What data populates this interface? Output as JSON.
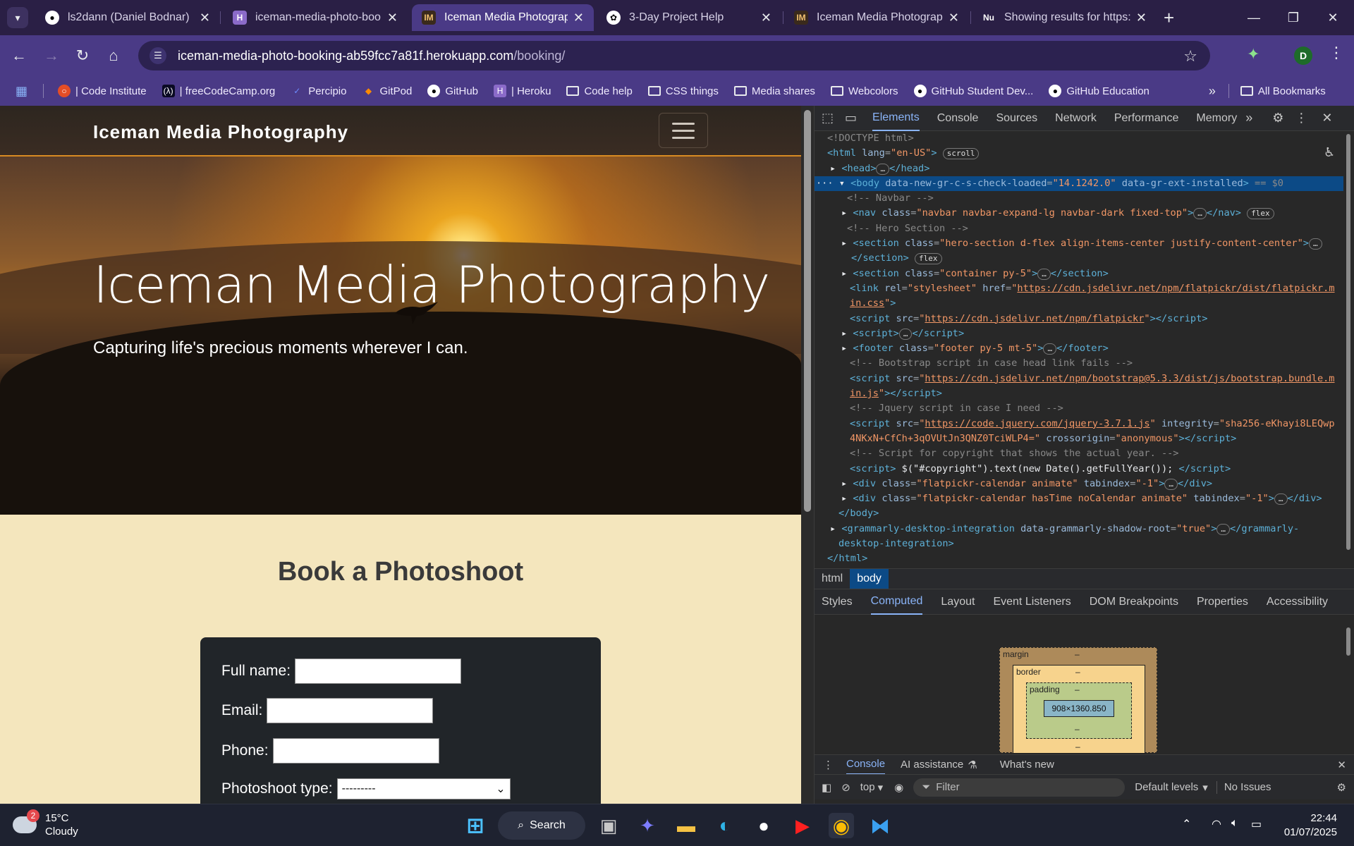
{
  "browser": {
    "tabs": [
      {
        "title": "ls2dann (Daniel Bodnar)",
        "favicon": "github-icon"
      },
      {
        "title": "iceman-media-photo-boo",
        "favicon": "heroku-icon"
      },
      {
        "title": "Iceman Media Photograph",
        "favicon": "im-icon",
        "active": true
      },
      {
        "title": "3-Day Project Help",
        "favicon": "chatgpt-icon"
      },
      {
        "title": "Iceman Media Photograph",
        "favicon": "im-icon"
      },
      {
        "title": "Showing results for https:/",
        "favicon": "nu-icon"
      }
    ],
    "url_host": "iceman-media-photo-booking-ab59fcc7a81f.herokuapp.com",
    "url_path": "/booking/",
    "profile_initial": "D",
    "bookmarks": [
      {
        "label": "| Code Institute",
        "icon": "code-institute-icon"
      },
      {
        "label": "| freeCodeCamp.org",
        "icon": "freecodecamp-icon"
      },
      {
        "label": "Percipio",
        "icon": "percipio-icon"
      },
      {
        "label": "GitPod",
        "icon": "gitpod-icon"
      },
      {
        "label": "GitHub",
        "icon": "github-icon"
      },
      {
        "label": "| Heroku",
        "icon": "heroku-icon"
      },
      {
        "label": "Code help",
        "icon": "folder-icon"
      },
      {
        "label": "CSS things",
        "icon": "folder-icon"
      },
      {
        "label": "Media shares",
        "icon": "folder-icon"
      },
      {
        "label": "Webcolors",
        "icon": "folder-icon"
      },
      {
        "label": "GitHub Student Dev...",
        "icon": "github-icon"
      },
      {
        "label": "GitHub Education",
        "icon": "github-icon"
      }
    ],
    "all_bookmarks": "All Bookmarks"
  },
  "site": {
    "brand": "Iceman Media Photography",
    "hero_title": "Iceman Media Photography",
    "hero_subtitle": "Capturing life's precious moments wherever I can.",
    "booking_heading": "Book a Photoshoot",
    "form": {
      "full_name_label": "Full name:",
      "email_label": "Email:",
      "phone_label": "Phone:",
      "type_label": "Photoshoot type:",
      "type_selected": "---------"
    }
  },
  "devtools": {
    "tabs": [
      "Elements",
      "Console",
      "Sources",
      "Network",
      "Performance",
      "Memory"
    ],
    "active_tab": "Elements",
    "breadcrumbs": [
      "html",
      "body"
    ],
    "sub_tabs": [
      "Styles",
      "Computed",
      "Layout",
      "Event Listeners",
      "DOM Breakpoints",
      "Properties",
      "Accessibility"
    ],
    "active_sub_tab": "Computed",
    "box_model": {
      "margin": "margin",
      "border": "border",
      "padding": "padding",
      "content": "908×1360.850",
      "dash": "–"
    },
    "drawer_tabs": [
      "Console",
      "AI assistance",
      "What's new"
    ],
    "context": "top",
    "filter_placeholder": "Filter",
    "levels": "Default levels",
    "issues": "No Issues"
  },
  "taskbar": {
    "temperature": "15°C",
    "condition": "Cloudy",
    "notification_count": "2",
    "search_label": "Search",
    "time": "22:44",
    "date": "01/07/2025"
  }
}
